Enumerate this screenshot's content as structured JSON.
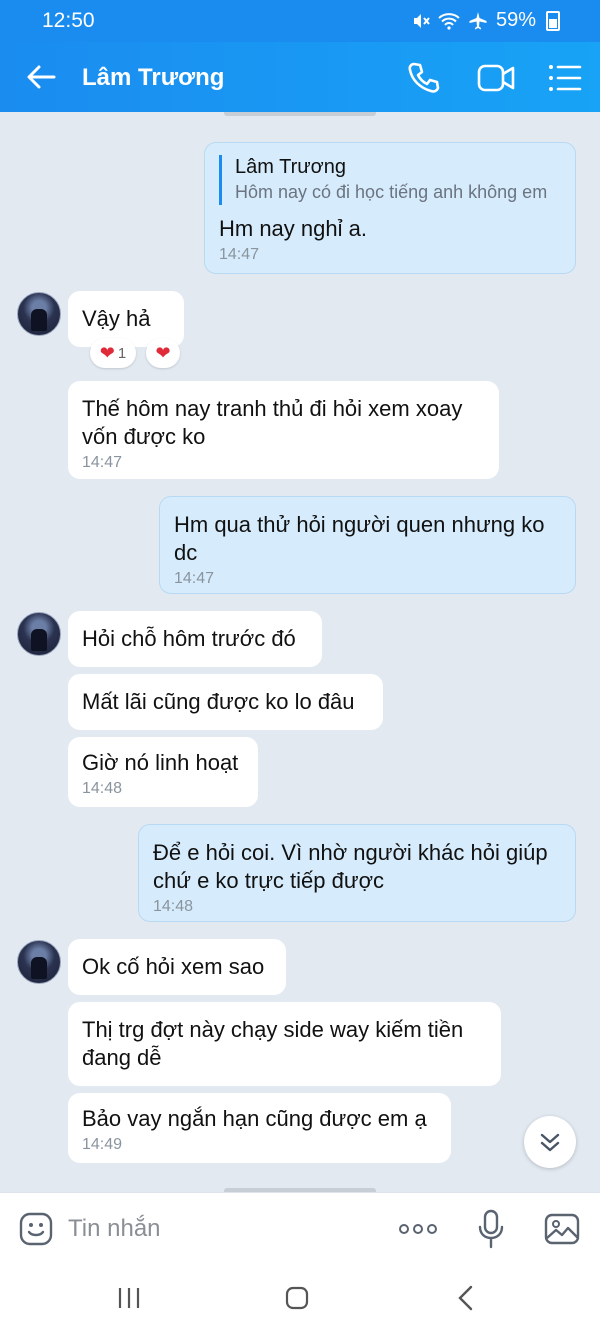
{
  "status_bar": {
    "time": "12:50",
    "battery": "59%"
  },
  "header": {
    "contact_name": "Lâm Trương"
  },
  "messages": [
    {
      "quote_name": "Lâm Trương",
      "quote_text": "Hôm nay có đi học tiếng anh không em",
      "text": "Hm nay nghỉ a.",
      "time": "14:47"
    },
    {
      "text": "Vậy hả",
      "reaction_count": "1"
    },
    {
      "text": "Thế hôm nay tranh thủ đi hỏi xem xoay vốn được ko",
      "time": "14:47"
    },
    {
      "text": "Hm qua thử hỏi người quen nhưng ko dc",
      "time": "14:47"
    },
    {
      "text": "Hỏi chỗ hôm trước đó"
    },
    {
      "text": "Mất lãi cũng được ko lo đâu"
    },
    {
      "text": "Giờ nó linh hoạt",
      "time": "14:48"
    },
    {
      "text": "Để e hỏi coi. Vì nhờ người khác hỏi giúp chứ e ko trực tiếp được",
      "time": "14:48"
    },
    {
      "text": "Ok cố hỏi xem sao"
    },
    {
      "text": "Thị trg đợt này chạy side way kiếm tiền đang dễ"
    },
    {
      "text": "Bảo vay ngắn hạn cũng được em ạ",
      "time": "14:49"
    }
  ],
  "composer": {
    "placeholder": "Tin nhắn"
  },
  "colors": {
    "header": "#1a8cf0",
    "outgoing_bubble": "#d6ecfc",
    "incoming_bubble": "#ffffff",
    "chat_bg": "#e2e9f1"
  },
  "icons": [
    "back-arrow-icon",
    "phone-icon",
    "video-call-icon",
    "menu-icon",
    "emoji-icon",
    "more-icon",
    "mic-icon",
    "image-icon",
    "scroll-down-icon"
  ]
}
